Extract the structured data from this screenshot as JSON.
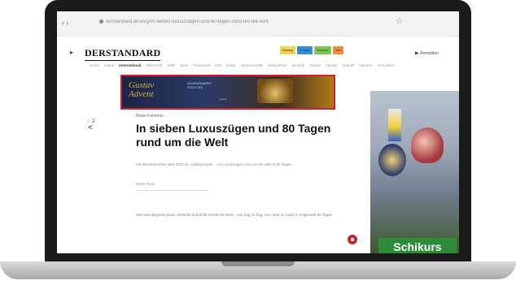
{
  "browser": {
    "nav_arrows": "‹ ›",
    "url": "derstandard.at/story/in-sieben-luxuszuegen-und-80-tagen-rund-um-die-welt",
    "star": "☆"
  },
  "site": {
    "left_icon": "▸",
    "logo": "DERSTANDARD",
    "pills": [
      {
        "label": "Eintrag",
        "color": "#f5d547"
      },
      {
        "label": "ePaper",
        "color": "#2f8fd8"
      },
      {
        "label": "Schwarz",
        "color": "#7ec850"
      },
      {
        "label": "Abo",
        "color": "#f08a3c"
      }
    ],
    "account": "Anmelden",
    "nav_items": [
      "Home",
      "Inland",
      "International",
      "Wirtschaft",
      "Web",
      "Sport",
      "Panorama",
      "Etat",
      "Kultur",
      "Wissenschaft",
      "Gesundheit",
      "Lifestyle",
      "Reisen",
      "Familie",
      "Zukunft",
      "Karriere",
      "Immobilien"
    ]
  },
  "banner_ad": {
    "title_line1": "Gustav",
    "title_line2": "Advent",
    "mid_line1": "ADVENTMARKT",
    "mid_line2": "SCHLOSS",
    "dots": "• • •"
  },
  "article": {
    "comment_count": "♡ 2",
    "share_icon": "<",
    "kicker": "Reise Kolumne",
    "headline": "In sieben Luxuszügen und 80 Tagen rund um die Welt",
    "lead": "Für Eisenbahnfans wird 2024 ein Jubiläumsjahr – mit Luxuszügen rund um die Welt in 80 Tagen.",
    "author": "Reise Team",
    "body": "Wer eine Zugreise plant, entdeckt Schritt für Schritt die Welt – von Zug zu Zug, von Land zu Land, in insgesamt 80 Tagen."
  },
  "side_ad": {
    "label": "Schikurs",
    "close": "×"
  }
}
